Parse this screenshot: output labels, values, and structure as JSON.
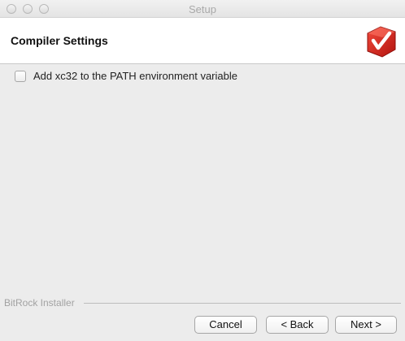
{
  "window": {
    "title": "Setup"
  },
  "header": {
    "title": "Compiler Settings",
    "logo_icon": "bitrock-checkmark-logo",
    "logo_color": "#d9201e"
  },
  "options": [
    {
      "label": "Add xc32 to the PATH environment variable",
      "checked": false
    }
  ],
  "footer": {
    "brand": "BitRock Installer",
    "cancel_label": "Cancel",
    "back_label": "< Back",
    "next_label": "Next >"
  }
}
